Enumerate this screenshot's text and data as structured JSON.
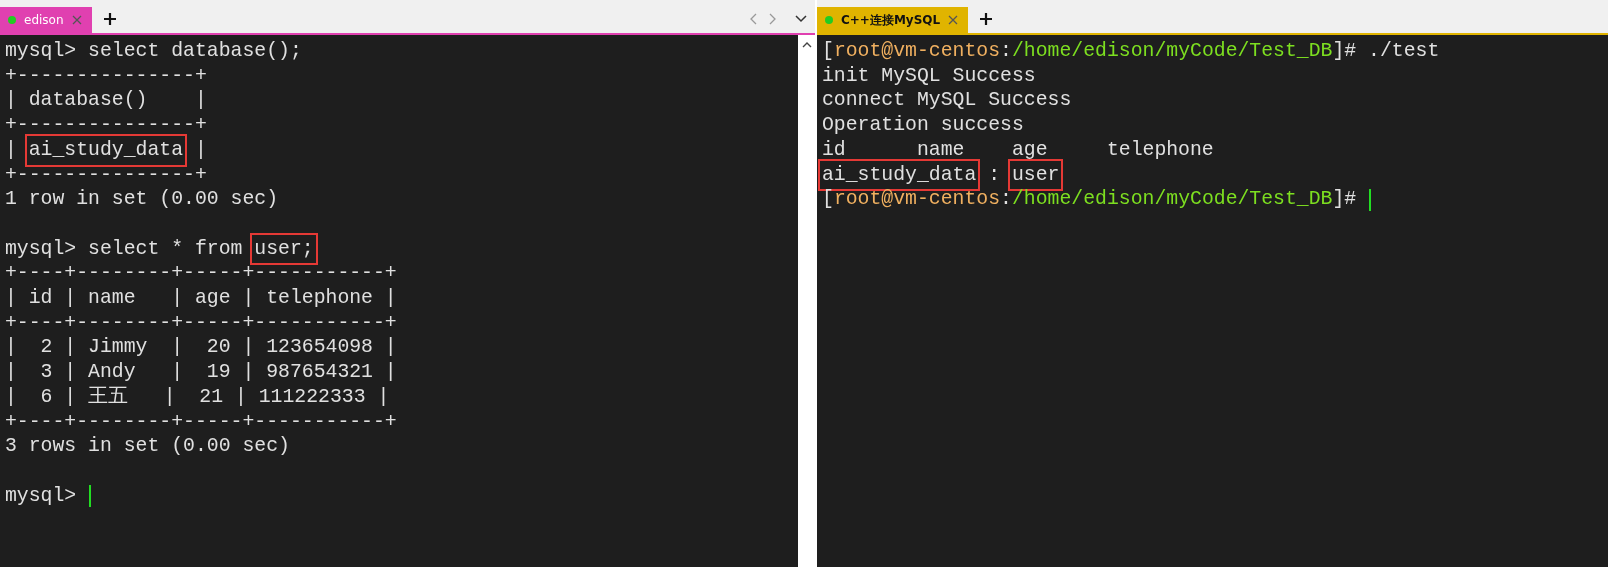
{
  "panes": [
    {
      "tab": {
        "label": "edison",
        "selected": true,
        "color": "#e040b0"
      },
      "scrollbar": true,
      "lines": [
        {
          "text": "mysql> select database();"
        },
        {
          "text": "+---------------+"
        },
        {
          "text": "| database()    |"
        },
        {
          "text": "+---------------+"
        },
        {
          "segments": [
            {
              "text": "| ",
              "kind": "plain",
              "boxed": false
            },
            {
              "text": "ai_study_data",
              "kind": "plain",
              "boxed": true
            },
            {
              "text": " |",
              "kind": "plain",
              "boxed": false
            }
          ]
        },
        {
          "text": "+---------------+"
        },
        {
          "text": "1 row in set (0.00 sec)"
        },
        {
          "kind": "blank"
        },
        {
          "segments": [
            {
              "text": "mysql> select * from ",
              "kind": "plain",
              "boxed": false
            },
            {
              "text": "user;",
              "kind": "plain",
              "boxed": true
            }
          ]
        },
        {
          "text": "+----+--------+-----+-----------+"
        },
        {
          "text": "| id | name   | age | telephone |"
        },
        {
          "text": "+----+--------+-----+-----------+"
        },
        {
          "text": "|  2 | Jimmy  |  20 | 123654098 |"
        },
        {
          "text": "|  3 | Andy   |  19 | 987654321 |"
        },
        {
          "text": "|  6 | 王五   |  21 | 111222333 |"
        },
        {
          "text": "+----+--------+-----+-----------+"
        },
        {
          "text": "3 rows in set (0.00 sec)"
        },
        {
          "kind": "blank"
        },
        {
          "text": "mysql> ",
          "cursor": true
        }
      ]
    },
    {
      "tab": {
        "label": "C++连接MySQL",
        "selected": true,
        "color": "#e0b400"
      },
      "scrollbar": false,
      "lines": [
        {
          "segments": [
            {
              "text": "[",
              "kind": "plain",
              "boxed": false
            },
            {
              "text": "root@vm-centos",
              "kind": "user",
              "boxed": false
            },
            {
              "text": ":",
              "kind": "plain",
              "boxed": false
            },
            {
              "text": "/home/edison/myCode/Test_DB",
              "kind": "path",
              "boxed": false
            },
            {
              "text": "]# ./test",
              "kind": "plain",
              "boxed": false
            }
          ]
        },
        {
          "text": "init MySQL Success"
        },
        {
          "text": "connect MySQL Success"
        },
        {
          "text": "Operation success"
        },
        {
          "text": "id      name    age     telephone"
        },
        {
          "segments": [
            {
              "text": "ai_study_data",
              "kind": "plain",
              "boxed": true
            },
            {
              "text": " : ",
              "kind": "plain",
              "boxed": false
            },
            {
              "text": "user",
              "kind": "plain",
              "boxed": true
            }
          ]
        },
        {
          "segments": [
            {
              "text": "[",
              "kind": "plain",
              "boxed": false
            },
            {
              "text": "root@vm-centos",
              "kind": "user",
              "boxed": false
            },
            {
              "text": ":",
              "kind": "plain",
              "boxed": false
            },
            {
              "text": "/home/edison/myCode/Test_DB",
              "kind": "path",
              "boxed": false
            },
            {
              "text": "]# ",
              "kind": "plain",
              "boxed": false
            }
          ],
          "cursor": true
        }
      ]
    }
  ]
}
